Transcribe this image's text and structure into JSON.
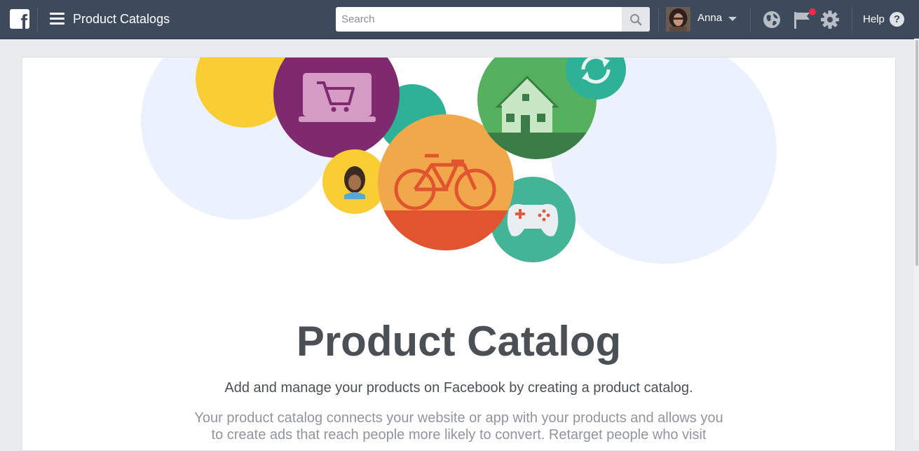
{
  "app": {
    "logo_letter": "f",
    "page_title": "Product Catalogs"
  },
  "search": {
    "placeholder": "Search",
    "value": ""
  },
  "user": {
    "name": "Anna"
  },
  "help": {
    "label": "Help",
    "glyph": "?"
  },
  "icons": [
    "facebook-logo",
    "menu-icon",
    "search-icon",
    "avatar",
    "chevron-down-icon",
    "globe-icon",
    "flag-icon",
    "gear-icon",
    "help-icon"
  ],
  "notification_dot_color": "#f02849",
  "hero_illustration": [
    "shopping-cart-laptop",
    "house",
    "bicycle",
    "person",
    "sync-arrows",
    "game-controller"
  ],
  "main": {
    "heading": "Product Catalog",
    "subheading": "Add and manage your products on Facebook by creating a product catalog.",
    "description": "Your product catalog connects your website or app with your products and allows you to create ads that reach people more likely to convert. Retarget people who visit"
  },
  "colors": {
    "topbar": "#3d4a5c",
    "page_background": "#e9ebee",
    "heading": "#4b4f56",
    "description": "#90949c"
  }
}
